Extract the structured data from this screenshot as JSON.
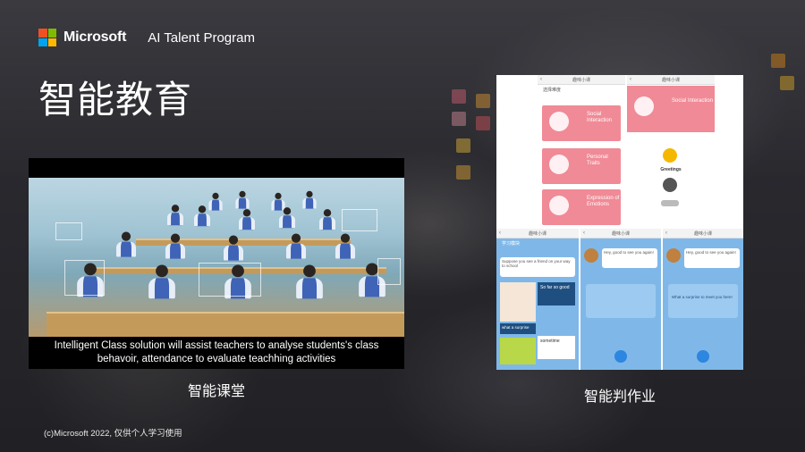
{
  "brand": {
    "logo_text": "Microsoft",
    "program": "AI Talent Program",
    "logo_colors": [
      "#f25022",
      "#7fba00",
      "#00a4ef",
      "#ffb900"
    ]
  },
  "slide": {
    "title": "智能教育",
    "left": {
      "caption": "Intelligent Class solution will assist teachers to analyse students's class behavoir, attendance to evaluate teachhing activities",
      "label": "智能课堂"
    },
    "right": {
      "label": "智能判作业",
      "screens": {
        "top_left_title": "趣味小课",
        "top_left_sub": "选择难度",
        "cards": [
          "Social Interaction",
          "Personal Traits",
          "Expression of Emotions"
        ],
        "top_right_title": "趣味小课",
        "top_right_card": "Social Interaction",
        "greeting_word": "Greetings",
        "bottom_titles": [
          "趣味小课",
          "趣味小课",
          "趣味小课"
        ],
        "bottom_left_sub": "学习模块",
        "sentence": "Suppose you see a friend on your way to school",
        "tile_1": "So far so good",
        "tile_2": "what a surprise",
        "tile_3": "sometime",
        "bubble_1": "Hey, good to see you again!",
        "bubble_2": "Hey, good to see you again!",
        "option_1": "What a surprise to meet you here!"
      }
    },
    "copyright": "(c)Microsoft 2022, 仅供个人学习使用"
  },
  "colors": {
    "accent_pink": "#f08a96",
    "accent_blue": "#7fb8e8",
    "uniform_blue": "#3f63b6"
  }
}
